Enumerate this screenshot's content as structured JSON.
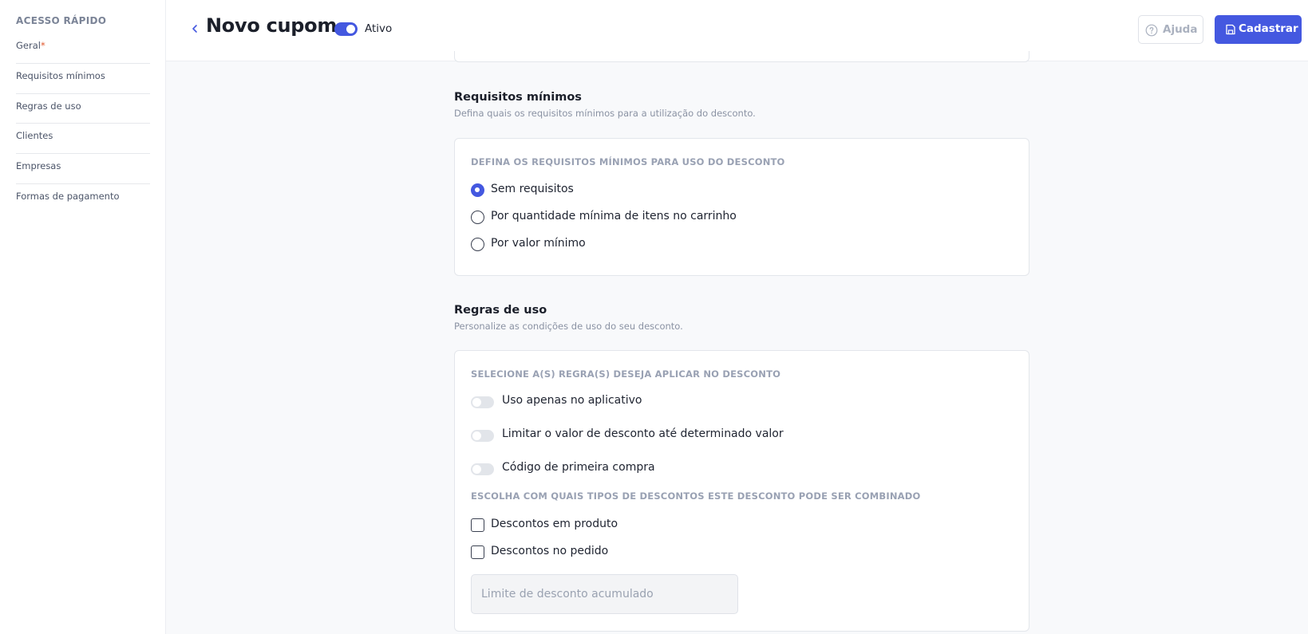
{
  "sidebar": {
    "title": "ACESSO RÁPIDO",
    "items": [
      {
        "label": "Geral",
        "required_mark": "*"
      },
      {
        "label": "Requisitos mínimos"
      },
      {
        "label": "Regras de uso"
      },
      {
        "label": "Clientes"
      },
      {
        "label": "Empresas"
      },
      {
        "label": "Formas de pagamento"
      }
    ]
  },
  "header": {
    "title": "Novo cupom",
    "status_label": "Ativo",
    "status_on": true,
    "help_label": "Ajuda",
    "save_label": "Cadastrar"
  },
  "requisitos": {
    "title": "Requisitos mínimos",
    "description": "Defina quais os requisitos mínimos para a utilização do desconto.",
    "card_label": "DEFINA OS REQUISITOS MÍNIMOS PARA USO DO DESCONTO",
    "options": [
      {
        "label": "Sem requisitos",
        "selected": true
      },
      {
        "label": "Por quantidade mínima de itens no carrinho",
        "selected": false
      },
      {
        "label": "Por valor mínimo",
        "selected": false
      }
    ]
  },
  "regras": {
    "title": "Regras de uso",
    "description": "Personalize as condições de uso do seu desconto.",
    "card_label": "SELECIONE A(S) REGRA(S) DESEJA APLICAR NO DESCONTO",
    "switches": [
      {
        "label": "Uso apenas no aplicativo",
        "on": false
      },
      {
        "label": "Limitar o valor de desconto até determinado valor",
        "on": false
      },
      {
        "label": "Código de primeira compra",
        "on": false
      }
    ],
    "combine_label": "ESCOLHA COM QUAIS TIPOS DE DESCONTOS ESTE DESCONTO PODE SER COMBINADO",
    "checkboxes": [
      {
        "label": "Descontos em produto",
        "checked": false
      },
      {
        "label": "Descontos no pedido",
        "checked": false
      }
    ],
    "limit_placeholder": "Limite de desconto acumulado",
    "limit_value": ""
  },
  "colors": {
    "accent": "#4458e0",
    "required": "#e0582d",
    "muted_label": "#99a1b3"
  }
}
